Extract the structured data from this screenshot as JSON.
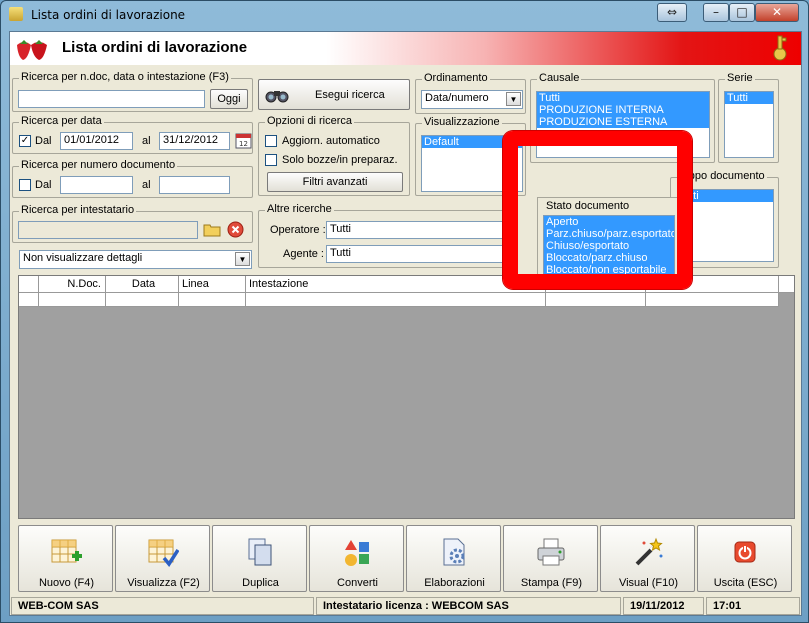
{
  "window": {
    "title": "Lista ordini di lavorazione",
    "buttons": {
      "restore": "⇔",
      "minimize": "–",
      "maximize": "□",
      "close": "✕"
    }
  },
  "header": {
    "title": "Lista ordini di lavorazione"
  },
  "search_ndoc": {
    "label": "Ricerca per n.doc, data o intestazione (F3)",
    "value": "",
    "button": "Oggi"
  },
  "search_date": {
    "label": "Ricerca per data",
    "checkbox_label": "Dal",
    "checked": true,
    "from": "01/01/2012",
    "to_label": "al",
    "to": "31/12/2012"
  },
  "search_number": {
    "label": "Ricerca per numero documento",
    "checkbox_label": "Dal",
    "checked": false,
    "from": "",
    "to_label": "al",
    "to": ""
  },
  "search_holder": {
    "label": "Ricerca per intestatario",
    "value": ""
  },
  "details_select": {
    "value": "Non visualizzare dettagli"
  },
  "search_button": {
    "label": "Esegui ricerca"
  },
  "options": {
    "label": "Opzioni di ricerca",
    "auto_update": "Aggiorn. automatico",
    "drafts_only": "Solo bozze/in preparaz.",
    "advanced_filters": "Filtri avanzati"
  },
  "other_searches": {
    "label": "Altre ricerche",
    "operator_label": "Operatore :",
    "operator_value": "Tutti",
    "agent_label": "Agente :",
    "agent_value": "Tutti"
  },
  "ordering": {
    "label": "Ordinamento",
    "value": "Data/numero"
  },
  "view": {
    "label": "Visualizzazione",
    "items": [
      "Default"
    ]
  },
  "causale": {
    "label": "Causale",
    "items": [
      "Tutti",
      "PRODUZIONE INTERNA",
      "PRODUZIONE ESTERNA"
    ]
  },
  "serie": {
    "label": "Serie",
    "items": [
      "Tutti"
    ]
  },
  "gruppo": {
    "label": "ruppo documento",
    "items": [
      "utti"
    ]
  },
  "stato": {
    "label": "Stato documento",
    "items": [
      "Aperto",
      "Parz.chiuso/parz.esportato",
      "Chiuso/esportato",
      "Bloccato/parz.chiuso",
      "Bloccato/non esportabile"
    ]
  },
  "grid": {
    "columns": [
      "",
      "N.Doc.",
      "Data",
      "Linea",
      "Intestazione",
      "",
      ""
    ]
  },
  "toolbar": [
    {
      "label": "Nuovo (F4)",
      "icon": "new-table-icon"
    },
    {
      "label": "Visualizza (F2)",
      "icon": "view-table-icon"
    },
    {
      "label": "Duplica",
      "icon": "duplicate-icon"
    },
    {
      "label": "Converti",
      "icon": "convert-icon"
    },
    {
      "label": "Elaborazioni",
      "icon": "process-icon"
    },
    {
      "label": "Stampa (F9)",
      "icon": "printer-icon"
    },
    {
      "label": "Visual (F10)",
      "icon": "magic-wand-icon"
    },
    {
      "label": "Uscita (ESC)",
      "icon": "power-icon"
    }
  ],
  "status": {
    "company": "WEB-COM SAS",
    "license": "Intestatario licenza : WEBCOM SAS",
    "date": "19/11/2012",
    "time": "17:01"
  },
  "colors": {
    "highlight": "#ff0000",
    "selection": "#3399ff",
    "header_gradient_end": "#e00000"
  }
}
